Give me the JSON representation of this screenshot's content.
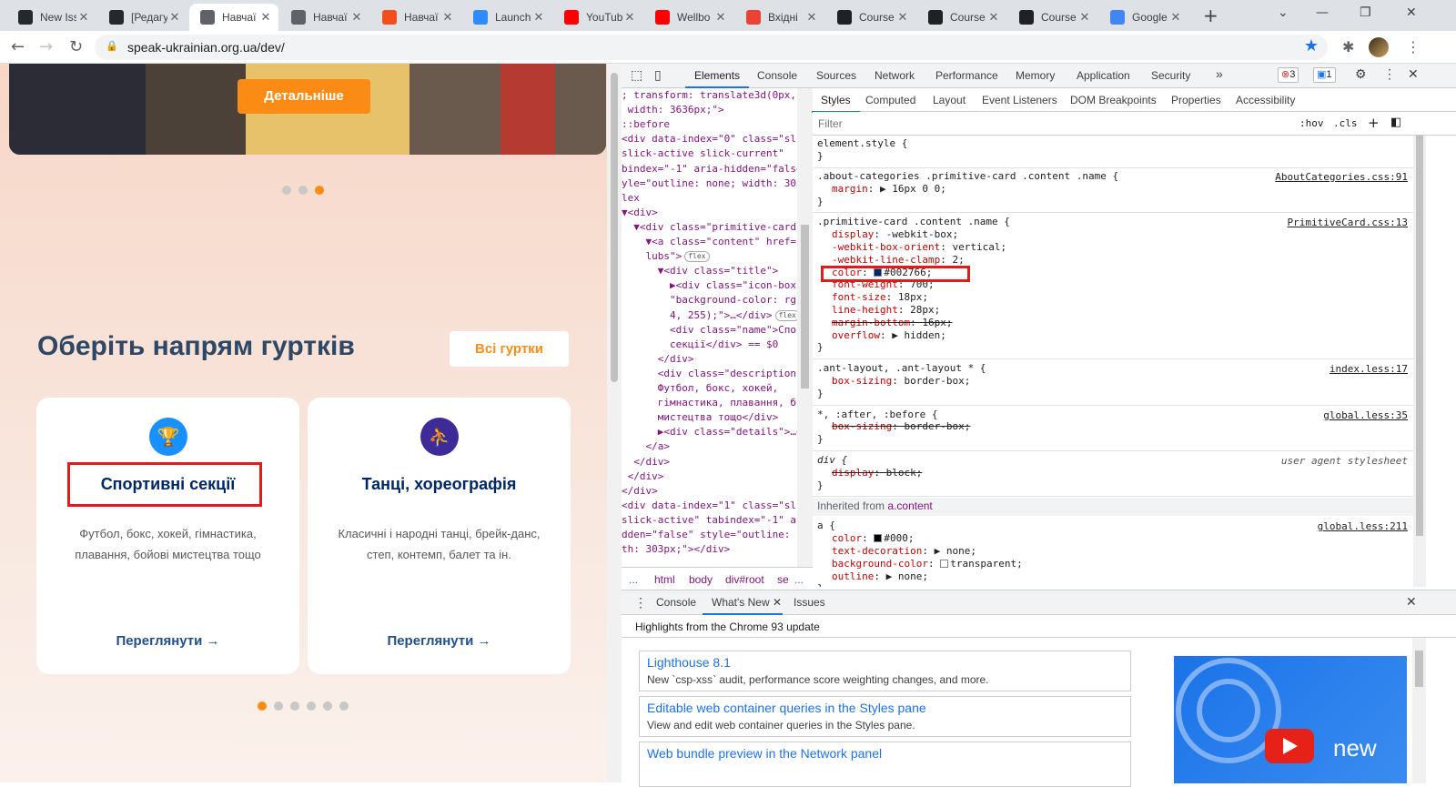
{
  "browser": {
    "tabs": [
      {
        "title": "New Iss",
        "favicon": "github-icon",
        "color": "#24292e"
      },
      {
        "title": "[Редагу",
        "favicon": "github-icon",
        "color": "#24292e"
      },
      {
        "title": "Навчаї",
        "favicon": "globe-icon",
        "color": "#5f6368",
        "active": true
      },
      {
        "title": "Навчаї",
        "favicon": "globe-icon",
        "color": "#5f6368"
      },
      {
        "title": "Навчаї",
        "favicon": "figma-icon",
        "color": "#f24e1e"
      },
      {
        "title": "Launch",
        "favicon": "zoom-icon",
        "color": "#2d8cff"
      },
      {
        "title": "YouTub",
        "favicon": "youtube-icon",
        "color": "#ff0000"
      },
      {
        "title": "Wellbo",
        "favicon": "youtube-icon",
        "color": "#ff0000"
      },
      {
        "title": "Вхідні",
        "favicon": "gmail-icon",
        "color": "#ea4335"
      },
      {
        "title": "Course",
        "favicon": "s-icon",
        "color": "#202124"
      },
      {
        "title": "Course",
        "favicon": "s-icon",
        "color": "#202124"
      },
      {
        "title": "Course",
        "favicon": "s-icon",
        "color": "#202124"
      },
      {
        "title": "Google",
        "favicon": "google-icon",
        "color": "#4285f4"
      }
    ],
    "url": "speak-ukrainian.org.ua/dev/"
  },
  "page": {
    "hero_button": "Детальніше",
    "section_title": "Оберіть напрям гуртків",
    "all_button": "Всі гуртки",
    "cards": [
      {
        "name": "Спортивні секції",
        "desc": "Футбол, бокс, хокей, гімнастика, плавання, бойові мистецтва тощо",
        "link": "Переглянути",
        "icon": "trophy-icon",
        "icon_color": "#1890ff"
      },
      {
        "name": "Танці, хореографія",
        "desc": "Класичні і народні танці, брейк-данс, степ, контемп, балет та ін.",
        "link": "Переглянути",
        "icon": "dance-icon",
        "icon_color": "#3f2a9a"
      }
    ],
    "arrow": "→",
    "accent_color": "#fa8c16",
    "title_color": "#2d4764"
  },
  "devtools": {
    "main_tabs": [
      "Elements",
      "Console",
      "Sources",
      "Network",
      "Performance",
      "Memory",
      "Application",
      "Security"
    ],
    "more": "»",
    "errors": "3",
    "messages": "1",
    "styles_tabs": [
      "Styles",
      "Computed",
      "Layout",
      "Event Listeners",
      "DOM Breakpoints",
      "Properties",
      "Accessibility"
    ],
    "filter_placeholder": "Filter",
    "hov": ":hov",
    "cls": ".cls",
    "breadcrumbs": [
      "...",
      "html",
      "body",
      "div#root",
      "se",
      "..."
    ],
    "dom_lines": [
      "; transform: translate3d(0px,",
      " width: 3636px;\">",
      "::before",
      "<div data-index=\"0\" class=\"sli",
      "slick-active slick-current\"",
      "bindex=\"-1\" aria-hidden=\"false",
      "yle=\"outline: none; width: 303",
      "lex",
      "▼<div>",
      "  ▼<div class=\"primitive-card\"",
      "    ▼<a class=\"content\" href=\"",
      "    lubs\">",
      "      ▼<div class=\"title\">",
      "        ▶<div class=\"icon-box\"",
      "        \"background-color: rgb(",
      "        4, 255);\">…</div>",
      "        <div class=\"name\">Спо",
      "        секції</div> == $0",
      "      </div>",
      "      <div class=\"description",
      "      Футбол, бокс, хокей,",
      "      гімнастика, плавання, б",
      "      мистецтва тощо</div>",
      "      ▶<div class=\"details\">…<",
      "    </a>",
      "  </div>",
      " </div>",
      "</div>",
      "<div data-index=\"1\" class=\"sli",
      "slick-active\" tabindex=\"-1\" ar",
      "dden=\"false\" style=\"outline: r",
      "th: 303px;\"></div>"
    ],
    "flex_badge": "flex",
    "element_style": "element.style {",
    "rules": [
      {
        "selector": ".about-categories .primitive-card .content .name {",
        "source": "AboutCategories.css:91",
        "props": [
          {
            "name": "margin",
            "value": "▶ 16px 0 0;"
          }
        ]
      },
      {
        "selector": ".primitive-card .content .name {",
        "source": "PrimitiveCard.css:13",
        "props": [
          {
            "name": "display",
            "value": "-webkit-box;"
          },
          {
            "name": "-webkit-box-orient",
            "value": "vertical;"
          },
          {
            "name": "-webkit-line-clamp",
            "value": "2;"
          },
          {
            "name": "color",
            "value": "#002766;",
            "swatch": "#002766"
          },
          {
            "name": "font-weight",
            "value": "700;"
          },
          {
            "name": "font-size",
            "value": "18px;"
          },
          {
            "name": "line-height",
            "value": "28px;"
          },
          {
            "name": "margin-bottom",
            "value": "16px;",
            "strike": true
          },
          {
            "name": "overflow",
            "value": "▶ hidden;"
          }
        ]
      },
      {
        "selector": ".ant-layout, .ant-layout * {",
        "source": "index.less:17",
        "props": [
          {
            "name": "box-sizing",
            "value": "border-box;"
          }
        ]
      },
      {
        "selector": "*, :after, :before {",
        "source": "global.less:35",
        "props": [
          {
            "name": "box-sizing",
            "value": "border-box;",
            "strike": true
          }
        ]
      },
      {
        "selector": "div {",
        "source": "user agent stylesheet",
        "props": [
          {
            "name": "display",
            "value": "block;",
            "strike": true
          }
        ]
      }
    ],
    "inherited_label": "Inherited from",
    "inherited_from": "a.content",
    "a_rule": {
      "selector": "a {",
      "source": "global.less:211",
      "props": [
        {
          "name": "color",
          "value": "#000;",
          "swatch": "#000000"
        },
        {
          "name": "text-decoration",
          "value": "▶ none;"
        },
        {
          "name": "background-color",
          "value": "transparent;",
          "swatch": "transparent"
        },
        {
          "name": "outline",
          "value": "▶ none;"
        }
      ]
    },
    "close_brace": "}",
    "drawer_tabs": [
      "Console",
      "What's New",
      "Issues"
    ],
    "highlights": "Highlights from the Chrome 93 update",
    "whats_new": [
      {
        "title": "Lighthouse 8.1",
        "desc": "New `csp-xss` audit, performance score weighting changes, and more."
      },
      {
        "title": "Editable web container queries in the Styles pane",
        "desc": "View and edit web container queries in the Styles pane."
      },
      {
        "title": "Web bundle preview in the Network panel",
        "desc": ""
      }
    ],
    "promo_new": "new"
  }
}
